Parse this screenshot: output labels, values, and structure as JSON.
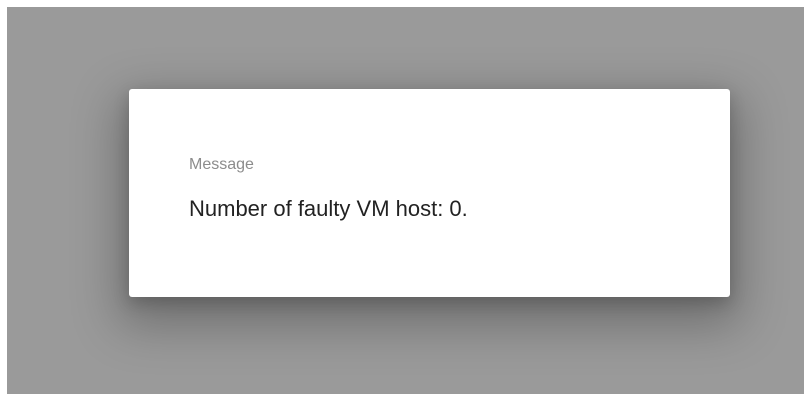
{
  "dialog": {
    "title": "Message",
    "message": "Number of faulty VM host: 0."
  },
  "colors": {
    "backdrop": "#9a9a9a",
    "dialog_background": "#ffffff",
    "title_text": "#8c8c8c",
    "message_text": "#222222"
  }
}
